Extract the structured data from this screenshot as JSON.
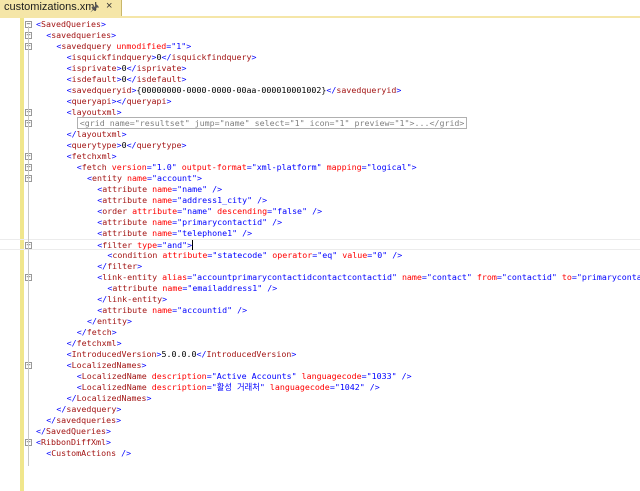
{
  "tab": {
    "title": "customizations.xml",
    "pin_icon": "pin-icon",
    "close_label": "×"
  },
  "editor": {
    "colors": {
      "bracket": "#0000ff",
      "tag": "#a31515",
      "attr": "#ff0000",
      "value": "#0000ff",
      "text": "#000000",
      "collapsed": "#808080"
    },
    "lines": [
      {
        "indent": 4,
        "fold": "minus",
        "text": "<SavedQueries>"
      },
      {
        "indent": 5,
        "fold": "minus",
        "text": "<savedqueries>"
      },
      {
        "indent": 6,
        "fold": "minus",
        "text": "<savedquery unmodified=\"1\">"
      },
      {
        "indent": 7,
        "fold": "",
        "text": "<isquickfindquery>0</isquickfindquery>"
      },
      {
        "indent": 7,
        "fold": "",
        "text": "<isprivate>0</isprivate>"
      },
      {
        "indent": 7,
        "fold": "",
        "text": "<isdefault>0</isdefault>"
      },
      {
        "indent": 7,
        "fold": "",
        "text": "<savedqueryid>{00000000-0000-0000-00aa-000010001002}</savedqueryid>"
      },
      {
        "indent": 7,
        "fold": "",
        "text": "<queryapi></queryapi>"
      },
      {
        "indent": 7,
        "fold": "minus",
        "text": "<layoutxml>"
      },
      {
        "indent": 8,
        "fold": "plus",
        "text": "<grid name=\"resultset\" jump=\"name\" select=\"1\" icon=\"1\" preview=\"1\">...</grid>",
        "collapsed": true
      },
      {
        "indent": 7,
        "fold": "",
        "text": "</layoutxml>"
      },
      {
        "indent": 7,
        "fold": "",
        "text": "<querytype>0</querytype>"
      },
      {
        "indent": 7,
        "fold": "minus",
        "text": "<fetchxml>"
      },
      {
        "indent": 8,
        "fold": "minus",
        "text": "<fetch version=\"1.0\" output-format=\"xml-platform\" mapping=\"logical\">"
      },
      {
        "indent": 9,
        "fold": "minus",
        "text": "<entity name=\"account\">"
      },
      {
        "indent": 10,
        "fold": "",
        "text": "<attribute name=\"name\" />"
      },
      {
        "indent": 10,
        "fold": "",
        "text": "<attribute name=\"address1_city\" />"
      },
      {
        "indent": 10,
        "fold": "",
        "text": "<order attribute=\"name\" descending=\"false\" />"
      },
      {
        "indent": 10,
        "fold": "",
        "text": "<attribute name=\"primarycontactid\" />"
      },
      {
        "indent": 10,
        "fold": "",
        "text": "<attribute name=\"telephone1\" />"
      },
      {
        "indent": 10,
        "fold": "minus",
        "text": "<filter type=\"and\">",
        "cursor": true
      },
      {
        "indent": 11,
        "fold": "",
        "text": "<condition attribute=\"statecode\" operator=\"eq\" value=\"0\" />"
      },
      {
        "indent": 10,
        "fold": "",
        "text": "</filter>"
      },
      {
        "indent": 10,
        "fold": "minus",
        "text": "<link-entity alias=\"accountprimarycontactidcontactcontactid\" name=\"contact\" from=\"contactid\" to=\"primarycontactid\" visible=\"false\" link-type=\"outer\">"
      },
      {
        "indent": 11,
        "fold": "",
        "text": "<attribute name=\"emailaddress1\" />"
      },
      {
        "indent": 10,
        "fold": "",
        "text": "</link-entity>"
      },
      {
        "indent": 10,
        "fold": "",
        "text": "<attribute name=\"accountid\" />"
      },
      {
        "indent": 9,
        "fold": "",
        "text": "</entity>"
      },
      {
        "indent": 8,
        "fold": "",
        "text": "</fetch>"
      },
      {
        "indent": 7,
        "fold": "",
        "text": "</fetchxml>"
      },
      {
        "indent": 7,
        "fold": "",
        "text": "<IntroducedVersion>5.0.0.0</IntroducedVersion>"
      },
      {
        "indent": 7,
        "fold": "minus",
        "text": "<LocalizedNames>"
      },
      {
        "indent": 8,
        "fold": "",
        "text": "<LocalizedName description=\"Active Accounts\" languagecode=\"1033\" />"
      },
      {
        "indent": 8,
        "fold": "",
        "text": "<LocalizedName description=\"활성 거래처\" languagecode=\"1042\" />"
      },
      {
        "indent": 7,
        "fold": "",
        "text": "</LocalizedNames>"
      },
      {
        "indent": 6,
        "fold": "",
        "text": "</savedquery>"
      },
      {
        "indent": 5,
        "fold": "",
        "text": "</savedqueries>"
      },
      {
        "indent": 4,
        "fold": "",
        "text": "</SavedQueries>"
      },
      {
        "indent": 4,
        "fold": "minus",
        "text": "<RibbonDiffXml>"
      },
      {
        "indent": 5,
        "fold": "",
        "text": "<CustomActions />"
      }
    ]
  }
}
